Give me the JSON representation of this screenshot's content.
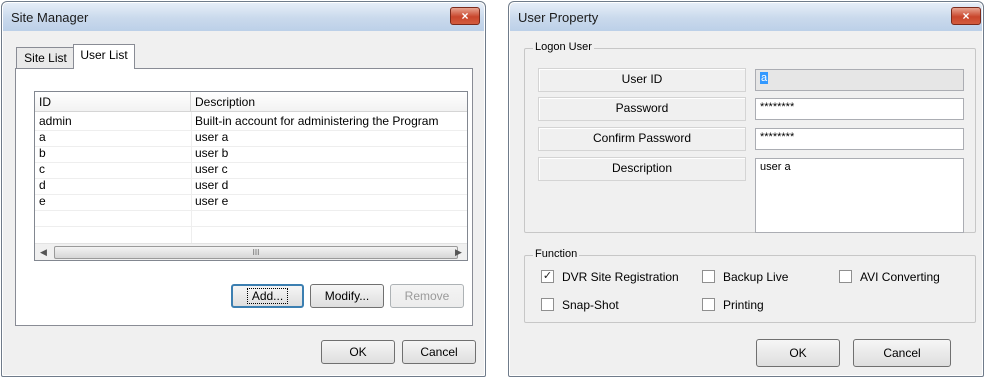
{
  "site_manager": {
    "title": "Site Manager",
    "close_glyph": "×",
    "tabs": [
      {
        "label": "Site List",
        "active": false
      },
      {
        "label": "User List",
        "active": true
      }
    ],
    "columns": [
      "ID",
      "Description"
    ],
    "rows": [
      {
        "id": "admin",
        "description": "Built-in account for administering the Program"
      },
      {
        "id": "a",
        "description": "user a"
      },
      {
        "id": "b",
        "description": "user b"
      },
      {
        "id": "c",
        "description": "user c"
      },
      {
        "id": "d",
        "description": "user d"
      },
      {
        "id": "e",
        "description": "user e"
      }
    ],
    "scroll_left_glyph": "◀",
    "scroll_right_glyph": "▶",
    "scroll_thumb_glyph": "III",
    "buttons": {
      "add": "Add...",
      "modify": "Modify...",
      "remove": "Remove",
      "ok": "OK",
      "cancel": "Cancel"
    }
  },
  "user_property": {
    "title": "User Property",
    "close_glyph": "×",
    "logon_group": "Logon User",
    "fields": {
      "user_id_label": "User ID",
      "user_id_value": "a",
      "password_label": "Password",
      "password_value": "********",
      "confirm_label": "Confirm Password",
      "confirm_value": "********",
      "description_label": "Description",
      "description_value": "user a"
    },
    "function_group": "Function",
    "checkboxes": [
      {
        "label": "DVR Site Registration",
        "checked": true
      },
      {
        "label": "Backup Live",
        "checked": false
      },
      {
        "label": "AVI Converting",
        "checked": false
      },
      {
        "label": "Snap-Shot",
        "checked": false
      },
      {
        "label": "Printing",
        "checked": false
      }
    ],
    "check_glyph": "✓",
    "buttons": {
      "ok": "OK",
      "cancel": "Cancel"
    }
  }
}
